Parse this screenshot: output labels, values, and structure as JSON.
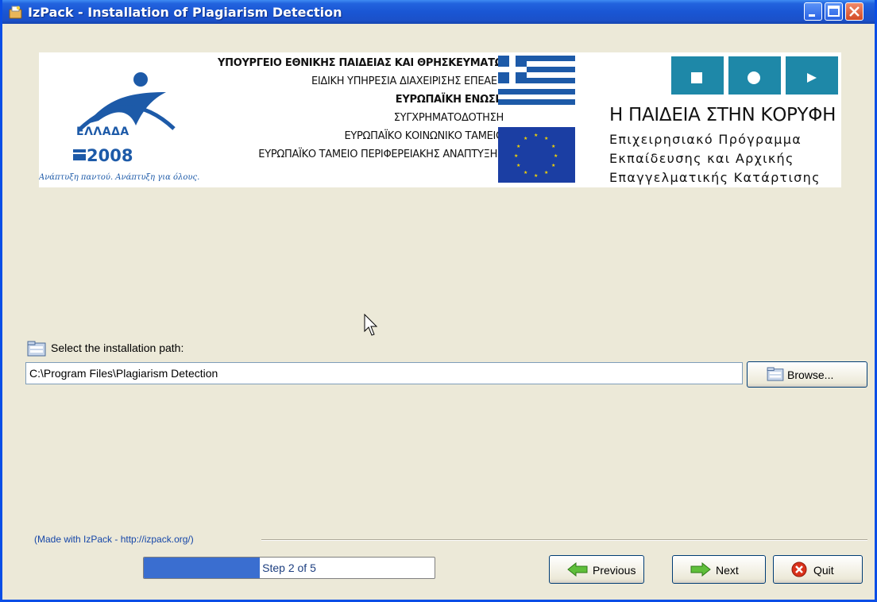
{
  "window": {
    "title": "IzPack - Installation of Plagiarism Detection"
  },
  "banner": {
    "ministry_lines": [
      "ΥΠΟΥΡΓΕΙΟ ΕΘΝΙΚΗΣ ΠΑΙΔΕΙΑΣ ΚΑΙ ΘΡΗΣΚΕΥΜΑΤΩΝ",
      "ΕΙΔΙΚΗ ΥΠΗΡΕΣΙΑ ΔΙΑΧΕΙΡΙΣΗΣ ΕΠΕΑΕΚ",
      "ΕΥΡΩΠΑΪΚΗ ΕΝΩΣΗ",
      "ΣΥΓΧΡΗΜΑΤΟΔΟΤΗΣΗ",
      "ΕΥΡΩΠΑΪΚΟ ΚΟΙΝΩΝΙΚΟ ΤΑΜΕΙΟ",
      "ΕΥΡΩΠΑΪΚΟ ΤΑΜΕΙΟ ΠΕΡΙΦΕΡΕΙΑΚΗΣ ΑΝΑΠΤΥΞΗΣ"
    ],
    "ellada_logo": "ΕΛΛΑΔΑ",
    "ellada_year": "2008",
    "ellada_motto": "Ανάπτυξη παντού. Ανάπτυξη για όλους.",
    "right_title": "Η ΠΑΙΔΕΙΑ ΣΤΗΝ ΚΟΡΥΦΗ",
    "right_sub_lines": [
      "Επιχειρησιακό Πρόγραμμα",
      "Εκπαίδευσης και Αρχικής",
      "Επαγγελματικής Κατάρτισης"
    ]
  },
  "installer": {
    "path_label": "Select the installation path:",
    "path_value": "C:\\Program Files\\Plagiarism Detection",
    "browse_label": "Browse..."
  },
  "footer": {
    "made_with": "(Made with IzPack - http://izpack.org/)",
    "progress_text": "Step 2 of 5",
    "progress_fraction": 0.4,
    "previous_label": "Previous",
    "next_label": "Next",
    "quit_label": "Quit"
  }
}
